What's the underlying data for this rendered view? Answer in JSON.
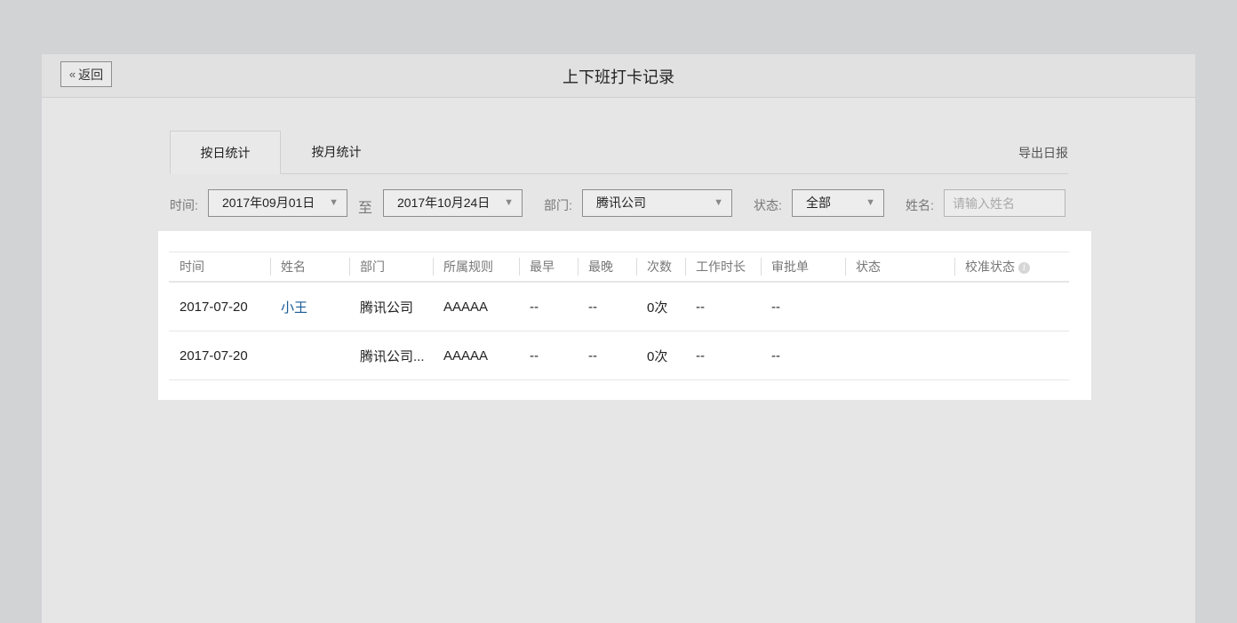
{
  "header": {
    "back_label": "返回",
    "back_icon": "«",
    "title": "上下班打卡记录"
  },
  "tabs": [
    {
      "label": "按日统计",
      "active": true
    },
    {
      "label": "按月统计",
      "active": false
    }
  ],
  "export_label": "导出日报",
  "filters": {
    "time_label": "时间:",
    "start_date": "2017年09月01日",
    "to_label": "至",
    "end_date": "2017年10月24日",
    "dept_label": "部门:",
    "dept_value": "腾讯公司",
    "status_label": "状态:",
    "status_value": "全部",
    "name_label": "姓名:",
    "name_placeholder": "请输入姓名",
    "name_value": ""
  },
  "table": {
    "columns": [
      "时间",
      "姓名",
      "部门",
      "所属规则",
      "最早",
      "最晚",
      "次数",
      "工作时长",
      "审批单",
      "状态",
      "校准状态"
    ],
    "rows": [
      {
        "date": "2017-07-20",
        "name": "小王",
        "dept": "腾讯公司",
        "rule": "AAAAA",
        "earliest": "--",
        "latest": "--",
        "count": "0次",
        "duration": "--",
        "approval": "--",
        "status": "",
        "calibration": ""
      },
      {
        "date": "2017-07-20",
        "name": "",
        "dept": "腾讯公司...",
        "rule": "AAAAA",
        "earliest": "--",
        "latest": "--",
        "count": "0次",
        "duration": "--",
        "approval": "--",
        "status": "",
        "calibration": ""
      }
    ]
  },
  "colors": {
    "background": "#d2d3d5",
    "panel": "#e6e6e6",
    "link": "#1a5a94"
  }
}
